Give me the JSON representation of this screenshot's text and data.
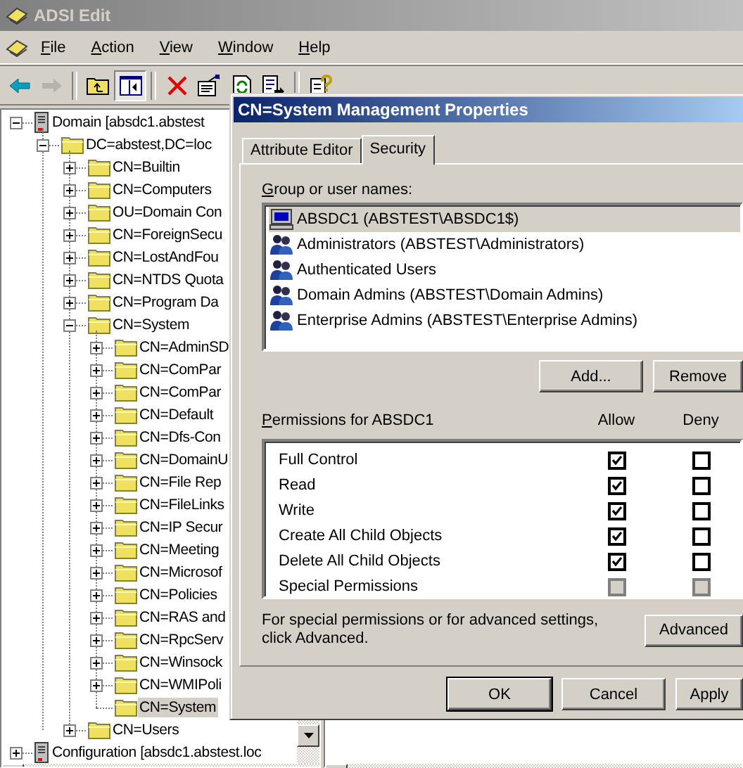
{
  "app": {
    "title": "ADSI Edit"
  },
  "menu": [
    "File",
    "Action",
    "View",
    "Window",
    "Help"
  ],
  "toolbar": [
    [
      {
        "kind": "back",
        "disabled": false,
        "pressed": false
      },
      {
        "kind": "forward",
        "disabled": true,
        "pressed": false
      }
    ],
    [
      {
        "kind": "up",
        "disabled": false,
        "pressed": false
      },
      {
        "kind": "panel",
        "disabled": false,
        "pressed": true
      }
    ],
    [
      {
        "kind": "delete",
        "disabled": false,
        "pressed": false
      },
      {
        "kind": "properties",
        "disabled": false,
        "pressed": false
      },
      {
        "kind": "refresh",
        "disabled": false,
        "pressed": false
      },
      {
        "kind": "export",
        "disabled": false,
        "pressed": false
      }
    ],
    [
      {
        "kind": "help",
        "disabled": false,
        "pressed": false
      }
    ]
  ],
  "tree": [
    {
      "label": "Domain [absdc1.abstest",
      "kind": "server",
      "expandable": true,
      "expanded": true,
      "selected": false,
      "children": [
        {
          "label": "DC=abstest,DC=loc",
          "kind": "folder",
          "expandable": true,
          "expanded": true,
          "selected": false,
          "children": [
            {
              "label": "CN=Builtin",
              "kind": "folder",
              "expandable": true,
              "expanded": false,
              "selected": false
            },
            {
              "label": "CN=Computers",
              "kind": "folder",
              "expandable": true,
              "expanded": false,
              "selected": false
            },
            {
              "label": "OU=Domain Con",
              "kind": "folder",
              "expandable": true,
              "expanded": false,
              "selected": false
            },
            {
              "label": "CN=ForeignSecu",
              "kind": "folder",
              "expandable": true,
              "expanded": false,
              "selected": false
            },
            {
              "label": "CN=LostAndFou",
              "kind": "folder",
              "expandable": true,
              "expanded": false,
              "selected": false
            },
            {
              "label": "CN=NTDS Quota",
              "kind": "folder",
              "expandable": true,
              "expanded": false,
              "selected": false
            },
            {
              "label": "CN=Program Da",
              "kind": "folder",
              "expandable": true,
              "expanded": false,
              "selected": false
            },
            {
              "label": "CN=System",
              "kind": "folder",
              "expandable": true,
              "expanded": true,
              "selected": false,
              "children": [
                {
                  "label": "CN=AdminSD",
                  "kind": "folder",
                  "expandable": true,
                  "expanded": false,
                  "selected": false
                },
                {
                  "label": "CN=ComPar",
                  "kind": "folder",
                  "expandable": true,
                  "expanded": false,
                  "selected": false
                },
                {
                  "label": "CN=ComPar",
                  "kind": "folder",
                  "expandable": true,
                  "expanded": false,
                  "selected": false
                },
                {
                  "label": "CN=Default",
                  "kind": "folder",
                  "expandable": true,
                  "expanded": false,
                  "selected": false
                },
                {
                  "label": "CN=Dfs-Con",
                  "kind": "folder",
                  "expandable": true,
                  "expanded": false,
                  "selected": false
                },
                {
                  "label": "CN=DomainU",
                  "kind": "folder",
                  "expandable": true,
                  "expanded": false,
                  "selected": false
                },
                {
                  "label": "CN=File Rep",
                  "kind": "folder",
                  "expandable": true,
                  "expanded": false,
                  "selected": false
                },
                {
                  "label": "CN=FileLinks",
                  "kind": "folder",
                  "expandable": true,
                  "expanded": false,
                  "selected": false
                },
                {
                  "label": "CN=IP Secur",
                  "kind": "folder",
                  "expandable": true,
                  "expanded": false,
                  "selected": false
                },
                {
                  "label": "CN=Meeting",
                  "kind": "folder",
                  "expandable": true,
                  "expanded": false,
                  "selected": false
                },
                {
                  "label": "CN=Microsof",
                  "kind": "folder",
                  "expandable": true,
                  "expanded": false,
                  "selected": false
                },
                {
                  "label": "CN=Policies",
                  "kind": "folder",
                  "expandable": true,
                  "expanded": false,
                  "selected": false
                },
                {
                  "label": "CN=RAS and",
                  "kind": "folder",
                  "expandable": true,
                  "expanded": false,
                  "selected": false
                },
                {
                  "label": "CN=RpcServ",
                  "kind": "folder",
                  "expandable": true,
                  "expanded": false,
                  "selected": false
                },
                {
                  "label": "CN=Winsock",
                  "kind": "folder",
                  "expandable": true,
                  "expanded": false,
                  "selected": false
                },
                {
                  "label": "CN=WMIPoli",
                  "kind": "folder",
                  "expandable": true,
                  "expanded": false,
                  "selected": false
                },
                {
                  "label": "CN=System",
                  "kind": "folder",
                  "expandable": false,
                  "expanded": false,
                  "selected": true
                }
              ]
            },
            {
              "label": "CN=Users",
              "kind": "folder",
              "expandable": true,
              "expanded": false,
              "selected": false
            }
          ]
        }
      ]
    },
    {
      "label": "Configuration [absdc1.abstest.loc",
      "kind": "server",
      "expandable": true,
      "expanded": false,
      "selected": false
    }
  ],
  "dialog": {
    "title": "CN=System Management Properties",
    "tabs": [
      {
        "label": "Attribute Editor",
        "selected": false
      },
      {
        "label": "Security",
        "selected": true
      }
    ],
    "group_label": "Group or user names:",
    "principals": [
      {
        "kind": "computer",
        "name": "ABSDC1 (ABSTEST\\ABSDC1$)",
        "selected": true
      },
      {
        "kind": "group",
        "name": "Administrators (ABSTEST\\Administrators)",
        "selected": false
      },
      {
        "kind": "group",
        "name": "Authenticated Users",
        "selected": false
      },
      {
        "kind": "group",
        "name": "Domain Admins (ABSTEST\\Domain Admins)",
        "selected": false
      },
      {
        "kind": "group",
        "name": "Enterprise Admins (ABSTEST\\Enterprise Admins)",
        "selected": false
      }
    ],
    "add_button": "Add...",
    "remove_button": "Remove",
    "permissions_label": "Permissions for ABSDC1",
    "allow_header": "Allow",
    "deny_header": "Deny",
    "permissions": [
      {
        "name": "Full Control",
        "allow": true,
        "deny": false,
        "disabled": false
      },
      {
        "name": "Read",
        "allow": true,
        "deny": false,
        "disabled": false
      },
      {
        "name": "Write",
        "allow": true,
        "deny": false,
        "disabled": false
      },
      {
        "name": "Create All Child Objects",
        "allow": true,
        "deny": false,
        "disabled": false
      },
      {
        "name": "Delete All Child Objects",
        "allow": true,
        "deny": false,
        "disabled": false
      },
      {
        "name": "Special Permissions",
        "allow": false,
        "deny": false,
        "disabled": true
      }
    ],
    "advanced_note": "For special permissions or for advanced settings, click Advanced.",
    "advanced_button": "Advanced",
    "buttons": [
      {
        "label": "OK",
        "default": true
      },
      {
        "label": "Cancel",
        "default": false
      },
      {
        "label": "Apply",
        "default": false
      }
    ]
  }
}
